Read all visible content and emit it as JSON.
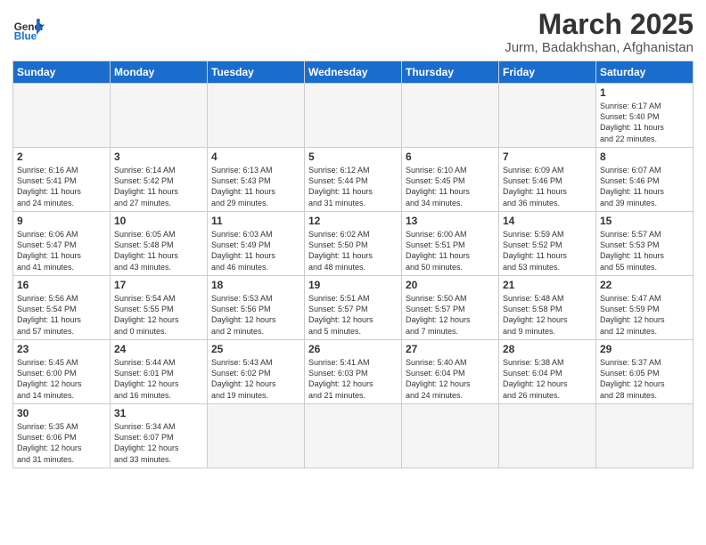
{
  "header": {
    "logo_general": "General",
    "logo_blue": "Blue",
    "month_title": "March 2025",
    "location": "Jurm, Badakhshan, Afghanistan"
  },
  "weekdays": [
    "Sunday",
    "Monday",
    "Tuesday",
    "Wednesday",
    "Thursday",
    "Friday",
    "Saturday"
  ],
  "days": [
    {
      "num": "",
      "info": ""
    },
    {
      "num": "",
      "info": ""
    },
    {
      "num": "",
      "info": ""
    },
    {
      "num": "",
      "info": ""
    },
    {
      "num": "",
      "info": ""
    },
    {
      "num": "",
      "info": ""
    },
    {
      "num": "1",
      "info": "Sunrise: 6:17 AM\nSunset: 5:40 PM\nDaylight: 11 hours\nand 22 minutes."
    },
    {
      "num": "2",
      "info": "Sunrise: 6:16 AM\nSunset: 5:41 PM\nDaylight: 11 hours\nand 24 minutes."
    },
    {
      "num": "3",
      "info": "Sunrise: 6:14 AM\nSunset: 5:42 PM\nDaylight: 11 hours\nand 27 minutes."
    },
    {
      "num": "4",
      "info": "Sunrise: 6:13 AM\nSunset: 5:43 PM\nDaylight: 11 hours\nand 29 minutes."
    },
    {
      "num": "5",
      "info": "Sunrise: 6:12 AM\nSunset: 5:44 PM\nDaylight: 11 hours\nand 31 minutes."
    },
    {
      "num": "6",
      "info": "Sunrise: 6:10 AM\nSunset: 5:45 PM\nDaylight: 11 hours\nand 34 minutes."
    },
    {
      "num": "7",
      "info": "Sunrise: 6:09 AM\nSunset: 5:46 PM\nDaylight: 11 hours\nand 36 minutes."
    },
    {
      "num": "8",
      "info": "Sunrise: 6:07 AM\nSunset: 5:46 PM\nDaylight: 11 hours\nand 39 minutes."
    },
    {
      "num": "9",
      "info": "Sunrise: 6:06 AM\nSunset: 5:47 PM\nDaylight: 11 hours\nand 41 minutes."
    },
    {
      "num": "10",
      "info": "Sunrise: 6:05 AM\nSunset: 5:48 PM\nDaylight: 11 hours\nand 43 minutes."
    },
    {
      "num": "11",
      "info": "Sunrise: 6:03 AM\nSunset: 5:49 PM\nDaylight: 11 hours\nand 46 minutes."
    },
    {
      "num": "12",
      "info": "Sunrise: 6:02 AM\nSunset: 5:50 PM\nDaylight: 11 hours\nand 48 minutes."
    },
    {
      "num": "13",
      "info": "Sunrise: 6:00 AM\nSunset: 5:51 PM\nDaylight: 11 hours\nand 50 minutes."
    },
    {
      "num": "14",
      "info": "Sunrise: 5:59 AM\nSunset: 5:52 PM\nDaylight: 11 hours\nand 53 minutes."
    },
    {
      "num": "15",
      "info": "Sunrise: 5:57 AM\nSunset: 5:53 PM\nDaylight: 11 hours\nand 55 minutes."
    },
    {
      "num": "16",
      "info": "Sunrise: 5:56 AM\nSunset: 5:54 PM\nDaylight: 11 hours\nand 57 minutes."
    },
    {
      "num": "17",
      "info": "Sunrise: 5:54 AM\nSunset: 5:55 PM\nDaylight: 12 hours\nand 0 minutes."
    },
    {
      "num": "18",
      "info": "Sunrise: 5:53 AM\nSunset: 5:56 PM\nDaylight: 12 hours\nand 2 minutes."
    },
    {
      "num": "19",
      "info": "Sunrise: 5:51 AM\nSunset: 5:57 PM\nDaylight: 12 hours\nand 5 minutes."
    },
    {
      "num": "20",
      "info": "Sunrise: 5:50 AM\nSunset: 5:57 PM\nDaylight: 12 hours\nand 7 minutes."
    },
    {
      "num": "21",
      "info": "Sunrise: 5:48 AM\nSunset: 5:58 PM\nDaylight: 12 hours\nand 9 minutes."
    },
    {
      "num": "22",
      "info": "Sunrise: 5:47 AM\nSunset: 5:59 PM\nDaylight: 12 hours\nand 12 minutes."
    },
    {
      "num": "23",
      "info": "Sunrise: 5:45 AM\nSunset: 6:00 PM\nDaylight: 12 hours\nand 14 minutes."
    },
    {
      "num": "24",
      "info": "Sunrise: 5:44 AM\nSunset: 6:01 PM\nDaylight: 12 hours\nand 16 minutes."
    },
    {
      "num": "25",
      "info": "Sunrise: 5:43 AM\nSunset: 6:02 PM\nDaylight: 12 hours\nand 19 minutes."
    },
    {
      "num": "26",
      "info": "Sunrise: 5:41 AM\nSunset: 6:03 PM\nDaylight: 12 hours\nand 21 minutes."
    },
    {
      "num": "27",
      "info": "Sunrise: 5:40 AM\nSunset: 6:04 PM\nDaylight: 12 hours\nand 24 minutes."
    },
    {
      "num": "28",
      "info": "Sunrise: 5:38 AM\nSunset: 6:04 PM\nDaylight: 12 hours\nand 26 minutes."
    },
    {
      "num": "29",
      "info": "Sunrise: 5:37 AM\nSunset: 6:05 PM\nDaylight: 12 hours\nand 28 minutes."
    },
    {
      "num": "30",
      "info": "Sunrise: 5:35 AM\nSunset: 6:06 PM\nDaylight: 12 hours\nand 31 minutes."
    },
    {
      "num": "31",
      "info": "Sunrise: 5:34 AM\nSunset: 6:07 PM\nDaylight: 12 hours\nand 33 minutes."
    },
    {
      "num": "",
      "info": ""
    },
    {
      "num": "",
      "info": ""
    },
    {
      "num": "",
      "info": ""
    },
    {
      "num": "",
      "info": ""
    },
    {
      "num": "",
      "info": ""
    }
  ]
}
